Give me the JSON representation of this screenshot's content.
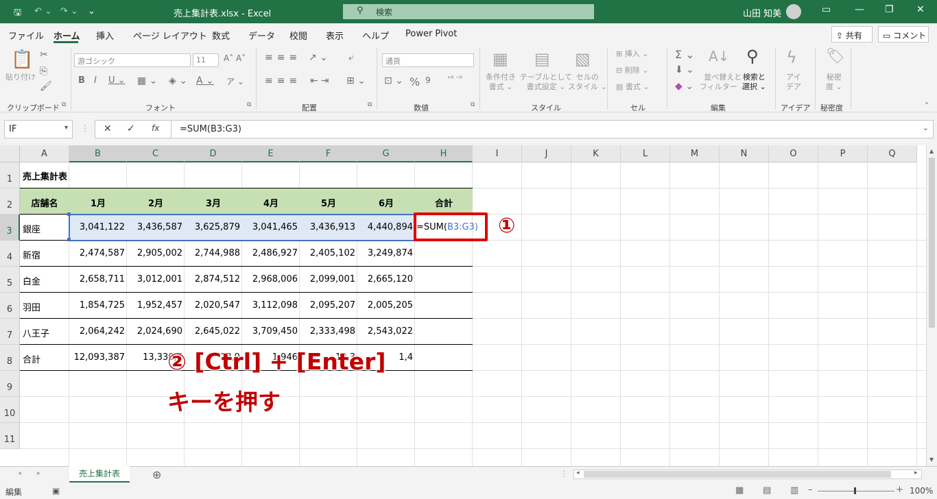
{
  "titlebar": {
    "title": "売上集計表.xlsx  -  Excel",
    "search_placeholder": "検索",
    "user": "山田 知美"
  },
  "menu": [
    "ファイル",
    "ホーム",
    "挿入",
    "ページ レイアウト",
    "数式",
    "データ",
    "校閲",
    "表示",
    "ヘルプ",
    "Power Pivot"
  ],
  "top_buttons": {
    "share": "共有",
    "comment": "コメント"
  },
  "ribbon": {
    "clipboard": {
      "paste": "貼り付け",
      "group": "クリップボード"
    },
    "font": {
      "name": "游ゴシック",
      "size": "11",
      "group": "フォント"
    },
    "alignment": {
      "group": "配置"
    },
    "number": {
      "format": "通貨",
      "group": "数値"
    },
    "styles": {
      "conditional_1": "条件付き",
      "conditional_2": "書式",
      "table_1": "テーブルとして",
      "table_2": "書式設定",
      "cell_1": "セルの",
      "cell_2": "スタイル",
      "group": "スタイル"
    },
    "cells": {
      "insert": "挿入",
      "delete": "削除",
      "format": "書式",
      "group": "セル"
    },
    "editing": {
      "sort_1": "並べ替えと",
      "sort_2": "フィルター",
      "find_1": "検索と",
      "find_2": "選択",
      "group": "編集"
    },
    "ideas": {
      "label_1": "アイ",
      "label_2": "デア",
      "group": "アイデア"
    },
    "sensitivity": {
      "label_1": "秘密",
      "label_2": "度",
      "group": "秘密度"
    }
  },
  "formula_bar": {
    "name_box": "IF",
    "formula": "=SUM(B3:G3)"
  },
  "columns": [
    "A",
    "B",
    "C",
    "D",
    "E",
    "F",
    "G",
    "H",
    "I",
    "J",
    "K",
    "L",
    "M",
    "N",
    "O",
    "P",
    "Q"
  ],
  "rows": [
    "1",
    "2",
    "3",
    "4",
    "5",
    "6",
    "7",
    "8",
    "9",
    "10",
    "11"
  ],
  "sheet": {
    "title": "売上集計表",
    "headers": [
      "店舗名",
      "1月",
      "2月",
      "3月",
      "4月",
      "5月",
      "6月",
      "合計"
    ],
    "data": [
      [
        "銀座",
        "3,041,122",
        "3,436,587",
        "3,625,879",
        "3,041,465",
        "3,436,913",
        "4,440,894"
      ],
      [
        "新宿",
        "2,474,587",
        "2,905,002",
        "2,744,988",
        "2,486,927",
        "2,405,102",
        "3,249,874"
      ],
      [
        "白金",
        "2,658,711",
        "3,012,001",
        "2,874,512",
        "2,968,006",
        "2,099,001",
        "2,665,120"
      ],
      [
        "羽田",
        "1,854,725",
        "1,952,457",
        "2,020,547",
        "3,112,098",
        "2,095,207",
        "2,005,205"
      ],
      [
        "八王子",
        "2,064,242",
        "2,024,690",
        "2,645,022",
        "3,709,450",
        "2,333,498",
        "2,543,022"
      ]
    ],
    "total_label": "合計",
    "total_visible": [
      "12,093,387",
      "13,330,7",
      "13,9",
      "1,946",
      "12,3",
      "1,4"
    ],
    "editing_cell": {
      "prefix": "=SUM(",
      "ref": "B3:G3",
      "suffix": ")"
    }
  },
  "annotations": {
    "step1": "①",
    "step2_line1": "② [Ctrl] + [Enter]",
    "step2_line2": "キーを押す"
  },
  "tabs": {
    "sheet": "売上集計表",
    "add": "⊕"
  },
  "status": {
    "mode": "編集",
    "zoom": "100%"
  },
  "colors": {
    "excel_green": "#217346",
    "header_fill": "#c6e0b4",
    "highlight": "#e00000",
    "ref_blue": "#4472c4"
  }
}
